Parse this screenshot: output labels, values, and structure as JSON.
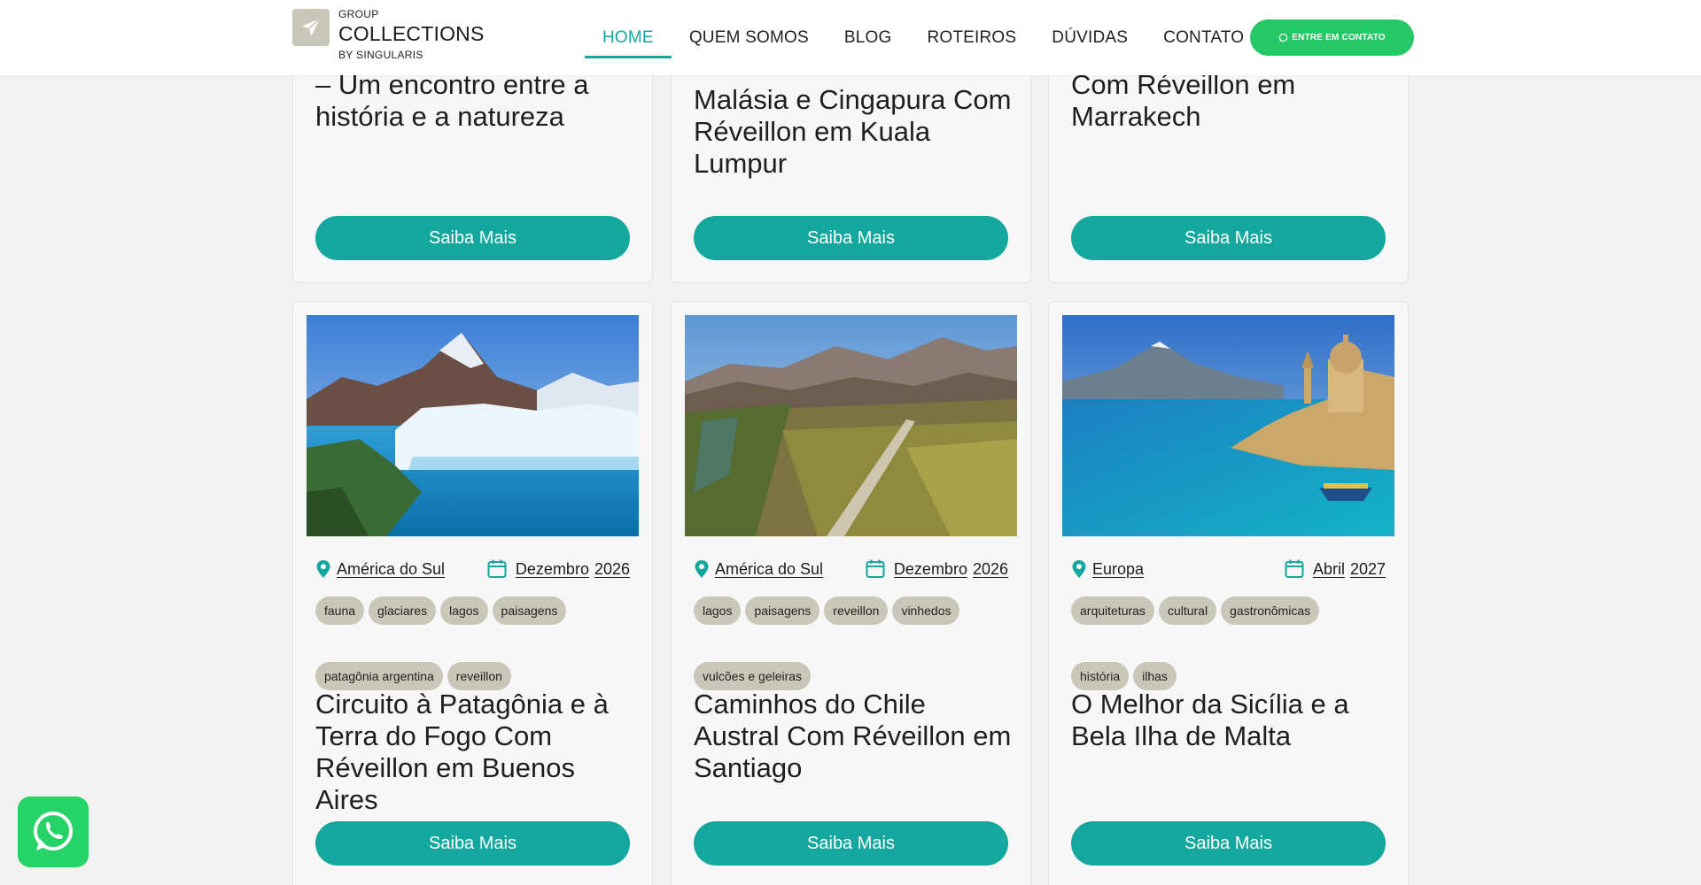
{
  "header": {
    "logo": {
      "line1": "GROUP",
      "line2": "COLLECTIONS",
      "line3": "BY SINGULARIS"
    },
    "nav": [
      {
        "label": "HOME",
        "active": true
      },
      {
        "label": "QUEM SOMOS"
      },
      {
        "label": "BLOG"
      },
      {
        "label": "ROTEIROS"
      },
      {
        "label": "DÚVIDAS"
      },
      {
        "label": "CONTATO"
      }
    ],
    "cta_label": "ENTRE EM CONTATO"
  },
  "top_cards": [
    {
      "title": "– Um encontro entre a história e a natureza",
      "button": "Saiba Mais"
    },
    {
      "title": "Malásia e Cingapura Com Réveillon em Kuala Lumpur",
      "button": "Saiba Mais"
    },
    {
      "title": "Com Réveillon em Marrakech",
      "button": "Saiba Mais"
    }
  ],
  "cards": [
    {
      "image": "glacier-lake-mountains",
      "region": "América do Sul",
      "month": "Dezembro",
      "year": "2026",
      "tags_row1": [
        "fauna",
        "glaciares",
        "lagos",
        "paisagens"
      ],
      "tags_row2": [
        "patagônia argentina",
        "reveillon"
      ],
      "title": "Circuito à Patagônia e à Terra do Fogo Com Réveillon em Buenos Aires",
      "button": "Saiba Mais"
    },
    {
      "image": "vineyard-valley-mountains",
      "region": "América do Sul",
      "month": "Dezembro",
      "year": "2026",
      "tags_row1": [
        "lagos",
        "paisagens",
        "reveillon",
        "vinhedos"
      ],
      "tags_row2": [
        "vulcões e geleiras"
      ],
      "title": "Caminhos do Chile Austral Com Réveillon em Santiago",
      "button": "Saiba Mais"
    },
    {
      "image": "coastal-city-sea",
      "region": "Europa",
      "month": "Abril",
      "year": "2027",
      "tags_row1": [
        "arquiteturas",
        "cultural",
        "gastronômicas"
      ],
      "tags_row2": [
        "história",
        "ilhas"
      ],
      "title": "O Melhor da Sicília e a Bela Ilha de Malta",
      "button": "Saiba Mais"
    }
  ],
  "colors": {
    "teal": "#13a79e",
    "green_cta": "#25c866",
    "tag_bg": "#c9c7b8",
    "whatsapp": "#25d366"
  },
  "icons": [
    "airplane-logo-icon",
    "whatsapp-icon",
    "map-pin-icon",
    "calendar-icon"
  ]
}
